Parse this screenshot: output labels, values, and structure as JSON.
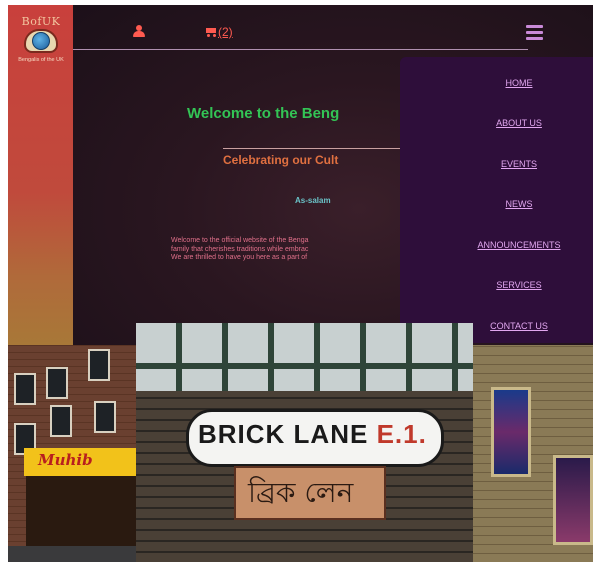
{
  "logo": {
    "name": "BofUK",
    "tagline": "Bengalis of the UK"
  },
  "header": {
    "cart_count": "(2)"
  },
  "hero": {
    "welcome": "Welcome to the Beng",
    "subtitle": "Celebrating our Cult",
    "greeting": "As-salam",
    "intro_lines": [
      "Welcome to the official website of the Benga",
      "family that cherishes traditions while embrac",
      "We are thrilled to have you here as a part of"
    ]
  },
  "nav": {
    "items": [
      "HOME",
      "ABOUT US",
      "EVENTS",
      "NEWS",
      "ANNOUNCEMENTS",
      "SERVICES",
      "CONTACT US"
    ]
  },
  "photos": {
    "shop_sign": "Muhib",
    "street_sign_main": "BRICK LANE",
    "street_sign_district": "E.1.",
    "street_sign_bengali": "ব্রিক লেন"
  },
  "colors": {
    "accent_red": "#ff5a50",
    "welcome_green": "#33c455",
    "subtitle_orange": "#e07040",
    "nav_link": "#e2a7f0",
    "nav_bg": "#2e0e3a"
  }
}
